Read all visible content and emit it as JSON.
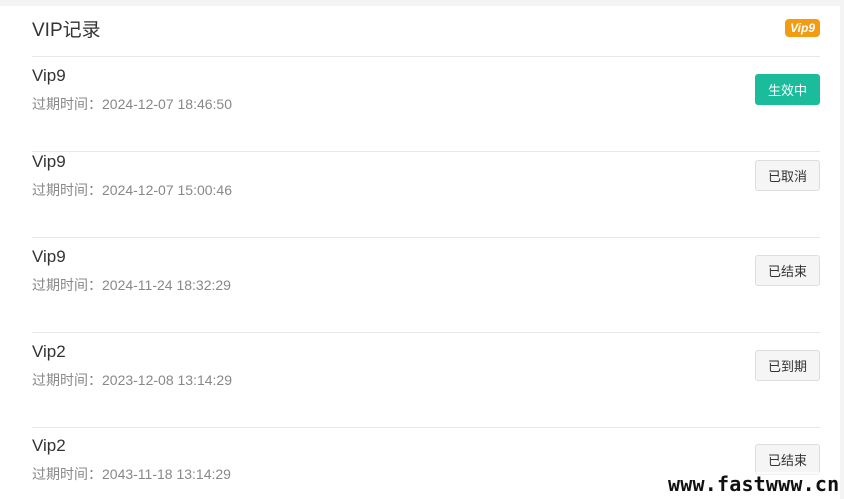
{
  "header": {
    "title": "VIP记录",
    "badge": "Vip9"
  },
  "records": [
    {
      "name": "Vip9",
      "expiry": "过期时间：2024-12-07 18:46:50",
      "status": "生效中"
    },
    {
      "name": "Vip9",
      "expiry": "过期时间：2024-12-07 15:00:46",
      "status": "已取消"
    },
    {
      "name": "Vip9",
      "expiry": "过期时间：2024-11-24 18:32:29",
      "status": "已结束"
    },
    {
      "name": "Vip2",
      "expiry": "过期时间：2023-12-08 13:14:29",
      "status": "已到期"
    },
    {
      "name": "Vip2",
      "expiry": "过期时间：2043-11-18 13:14:29",
      "status": "已结束"
    }
  ],
  "watermark": "www.fastwww.cn",
  "colors": {
    "active": "#1abc9c",
    "badge": "#f39c12"
  }
}
